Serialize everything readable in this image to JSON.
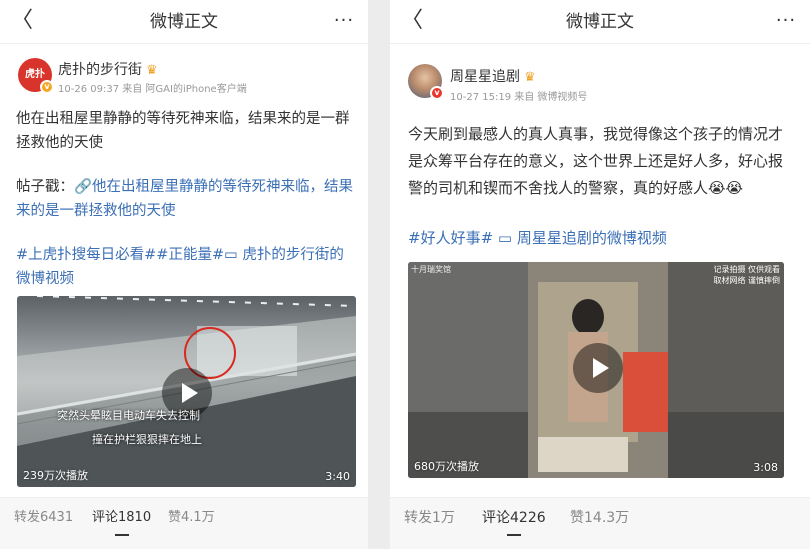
{
  "left": {
    "header": {
      "back": "〈",
      "title": "微博正文",
      "more": "···"
    },
    "author": {
      "name": "虎扑的步行街",
      "avatar_text": "虎扑",
      "meta": "10-26 09:37 来自 阿GAI的iPhone客户端"
    },
    "post": {
      "line1": "他在出租屋里静静的等待死神来临，结果来的是一群拯救他的天使",
      "line2_prefix": "帖子戳：",
      "line2_link": "🔗他在出租屋里静静的等待死神来临，结果来的是一群拯救他的天使",
      "tags": "#上虎扑搜每日必看##正能量#",
      "video_link": "▭ 虎扑的步行街的微博视频"
    },
    "video": {
      "subtitle1": "突然头晕眩目电动车失去控制",
      "subtitle2": "撞在护栏狠狠摔在地上",
      "plays": "239万次播放",
      "duration": "3:40"
    },
    "actions": {
      "repost": "转发6431",
      "comment": "评论1810",
      "like": "赞4.1万"
    }
  },
  "right": {
    "header": {
      "back": "〈",
      "title": "微博正文",
      "more": "···"
    },
    "author": {
      "name": "周星星追剧",
      "meta": "10-27 15:19 来自 微博视频号"
    },
    "post": {
      "text": "今天刷到最感人的真人真事，我觉得像这个孩子的情况才是众筹平台存在的意义，这个世界上还是好人多，好心报警的司机和锲而不舍找人的警察，真的好感人😭😭",
      "tag": "#好人好事#",
      "video_link": "▭ 周星星追剧的微博视频"
    },
    "video": {
      "watermark_left": "十月瑞奖馆",
      "watermark_right1": "记录拍摄  仅供观看",
      "watermark_right2": "取材网络  谨慎摔倒",
      "plays": "680万次播放",
      "duration": "3:08"
    },
    "actions": {
      "repost": "转发1万",
      "comment": "评论4226",
      "like": "赞14.3万"
    }
  },
  "colors": {
    "link": "#3b6fb6",
    "crown": "#f0a020",
    "vbadge": "#f5a623"
  }
}
